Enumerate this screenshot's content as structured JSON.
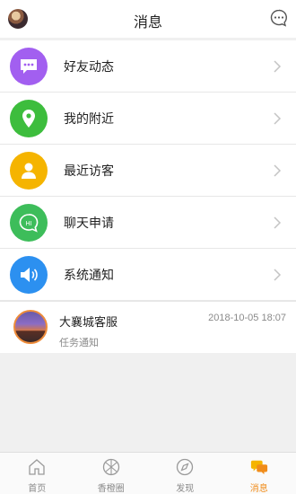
{
  "header": {
    "title": "消息"
  },
  "menu": [
    {
      "label": "好友动态",
      "icon": "friend-activity-icon",
      "color": "#a25ff0"
    },
    {
      "label": "我的附近",
      "icon": "location-icon",
      "color": "#3dbd3d"
    },
    {
      "label": "最近访客",
      "icon": "visitor-icon",
      "color": "#f5b400"
    },
    {
      "label": "聊天申请",
      "icon": "chat-request-icon",
      "color": "#3dbd5a"
    },
    {
      "label": "系统通知",
      "icon": "speaker-icon",
      "color": "#2c90f0"
    }
  ],
  "conversation": {
    "name": "大襄城客服",
    "time": "2018-10-05 18:07",
    "preview": "任务通知"
  },
  "tabs": [
    {
      "label": "首页",
      "icon": "home-icon"
    },
    {
      "label": "香橙圈",
      "icon": "orange-circle-icon"
    },
    {
      "label": "发现",
      "icon": "compass-icon"
    },
    {
      "label": "消息",
      "icon": "messages-icon",
      "active": true
    }
  ],
  "colors": {
    "accent": "#f08c1a"
  }
}
